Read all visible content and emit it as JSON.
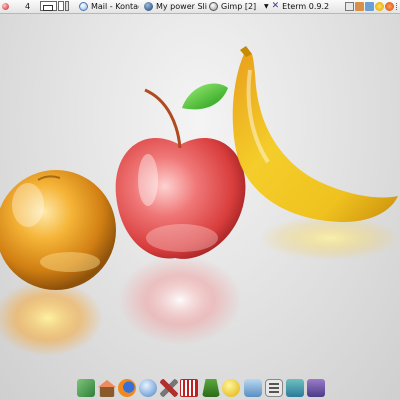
{
  "top_panel": {
    "workspace_number": "4",
    "tasks": [
      {
        "label": "Mail - Kontact",
        "icon": "mail-icon"
      },
      {
        "label": "My power Sli",
        "icon": "presentation-icon"
      },
      {
        "label": "Gimp [2]",
        "icon": "gimp-icon"
      },
      {
        "label": "Eterm 0.9.2",
        "icon": "eterm-icon"
      }
    ],
    "tray_icons": [
      "notes-icon",
      "folder-icon",
      "network-icon",
      "smiley-icon",
      "emoticon-icon"
    ]
  },
  "wallpaper": {
    "description_icon": "glass-fruit-wallpaper",
    "colors": {
      "orange": "#f0a020",
      "apple": "#e84a4a",
      "banana": "#f2c418",
      "leaf": "#3fbf2a"
    }
  },
  "dock": {
    "items": [
      "graphics-icon",
      "home-icon",
      "firefox-icon",
      "network-icon",
      "tools-icon",
      "calendar-icon",
      "trash-icon",
      "chat-icon",
      "mail-icon",
      "text-editor-icon",
      "image-viewer-icon",
      "settings-icon"
    ]
  }
}
